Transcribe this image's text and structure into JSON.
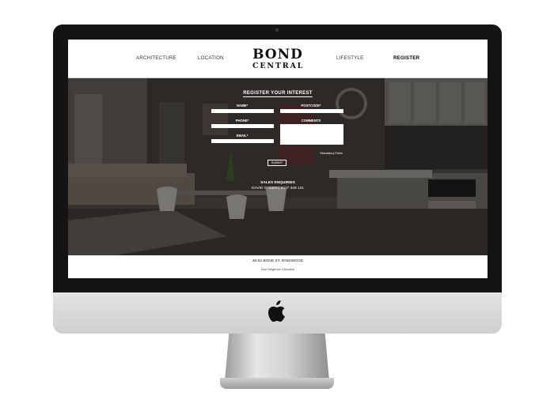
{
  "nav": {
    "links": [
      {
        "label": "ARCHITECTURE"
      },
      {
        "label": "LOCATION"
      },
      {
        "label": "LIFESTYLE"
      },
      {
        "label": "REGISTER"
      }
    ],
    "logo": {
      "line1": "BOND",
      "line2": "CENTRAL"
    }
  },
  "form": {
    "title": "REGISTER YOUR INTEREST",
    "fields": {
      "name_label": "NAME*",
      "postcode_label": "POSTCODE*",
      "phone_label": "PHONE*",
      "comments_label": "COMMENTS",
      "email_label": "EMAIL*"
    },
    "mandatory_note": "*Mandatory Fields",
    "submit_label": "SUBMIT"
  },
  "sales": {
    "title": "SALES ENQUIRIES",
    "contact": "DAVID GREEN | 0437 348 131"
  },
  "footer": {
    "address": "48-52 BOND ST, RINGWOOD",
    "link": "Due Diligence Checklist"
  },
  "colors": {
    "bezel": "#141414",
    "overlay": "#000000",
    "accent": "#ffffff"
  }
}
